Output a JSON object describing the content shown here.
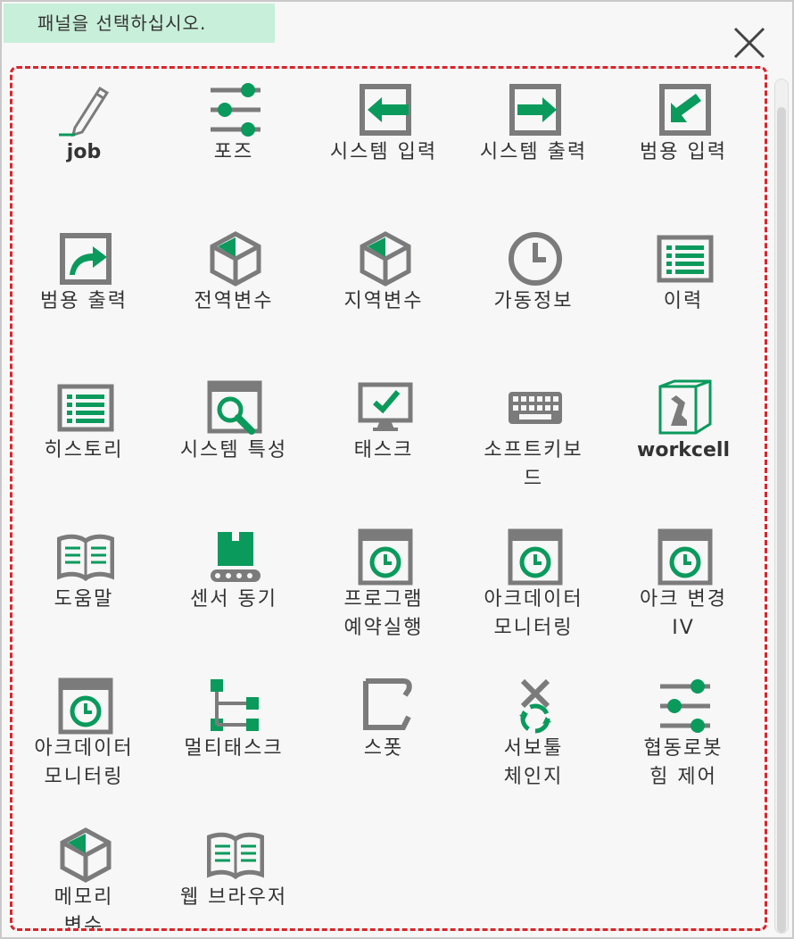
{
  "header": {
    "hint": "패널을 선택하십시오."
  },
  "colors": {
    "accent": "#0a9a5c",
    "gray": "#7b7b7b",
    "dashed_border": "#d9262b",
    "hint_bg": "#c8efd9"
  },
  "panels": [
    {
      "label": "job",
      "icon": "pencil-icon"
    },
    {
      "label": "포즈",
      "icon": "sliders-icon"
    },
    {
      "label": "시스템 입력",
      "icon": "input-arrow-icon"
    },
    {
      "label": "시스템 출력",
      "icon": "output-arrow-icon"
    },
    {
      "label": "범용 입력",
      "icon": "general-input-icon"
    },
    {
      "label": "범용 출력",
      "icon": "general-output-icon"
    },
    {
      "label": "전역변수",
      "icon": "cube-icon"
    },
    {
      "label": "지역변수",
      "icon": "cube-icon"
    },
    {
      "label": "가동정보",
      "icon": "clock-icon"
    },
    {
      "label": "이력",
      "icon": "list-icon"
    },
    {
      "label": "히스토리",
      "icon": "list-icon"
    },
    {
      "label": "시스템 특성",
      "icon": "magnifier-window-icon"
    },
    {
      "label": "태스크",
      "icon": "monitor-check-icon"
    },
    {
      "label": "소프트키보\n드",
      "icon": "keyboard-icon"
    },
    {
      "label": "workcell",
      "icon": "robot-cell-icon"
    },
    {
      "label": "도움말",
      "icon": "book-icon"
    },
    {
      "label": "센서 동기",
      "icon": "conveyor-icon"
    },
    {
      "label": "프로그램\n예약실행",
      "icon": "clock-window-icon"
    },
    {
      "label": "아크데이터\n모니터링",
      "icon": "clock-window-icon"
    },
    {
      "label": "아크 변경\nIV",
      "icon": "clock-window-icon"
    },
    {
      "label": "아크데이터\n모니터링",
      "icon": "clock-window-icon"
    },
    {
      "label": "멀티태스크",
      "icon": "multitask-icon"
    },
    {
      "label": "스폿",
      "icon": "spot-gun-icon"
    },
    {
      "label": "서보툴\n체인지",
      "icon": "tool-change-icon"
    },
    {
      "label": "협동로봇\n힘 제어",
      "icon": "sliders-icon"
    },
    {
      "label": "메모리\n변수",
      "icon": "cube-icon"
    },
    {
      "label": "웹 브라우저",
      "icon": "book-icon"
    }
  ]
}
